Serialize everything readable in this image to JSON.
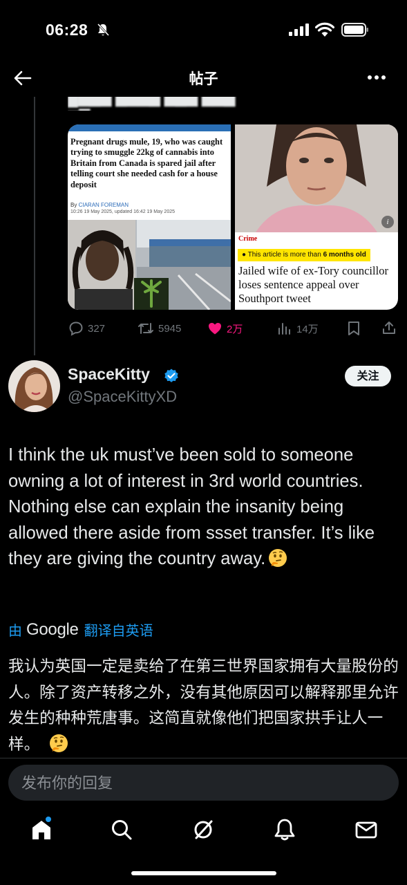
{
  "status_bar": {
    "time": "06:28"
  },
  "header": {
    "title": "帖子"
  },
  "quoted_post": {
    "article_left": {
      "headline": "Pregnant drugs mule, 19, who was caught trying to smuggle 22kg of cannabis into Britain from Canada is spared jail after telling court she needed cash for a house deposit",
      "byline_prefix": "By",
      "byline_author": "CIARAN FOREMAN",
      "dateline": "10:26 19 May 2025, updated 16:42 19 May 2025"
    },
    "article_right": {
      "section": "Crime",
      "age_prefix": "This article is more than",
      "age_value": "6 months old",
      "headline": "Jailed wife of ex-Tory councillor loses sentence appeal over Southport tweet"
    },
    "actions": {
      "replies": "327",
      "reposts": "5945",
      "likes": "2万",
      "views": "14万"
    }
  },
  "author": {
    "name": "SpaceKitty",
    "handle": "@SpaceKittyXD",
    "follow_label": "关注"
  },
  "post": {
    "text": "I think the uk must’ve been sold to someone owning a lot of interest in 3rd world countries. Nothing else can explain the insanity being allowed there aside from ssset transfer. It’s like they are giving the country away.",
    "translation_prefix": "由",
    "translation_provider": "Google",
    "translation_suffix": "翻译自英语",
    "translated_text": "我认为英国一定是卖给了在第三世界国家拥有大量股份的人。除了资产转移之外，没有其他原因可以解释那里允许发生的种种荒唐事。这简直就像他们把国家拱手让人一样。"
  },
  "reply": {
    "placeholder": "发布你的回复"
  },
  "colors": {
    "accent": "#1d9bf0",
    "like": "#f91880",
    "muted": "#71767b",
    "background": "#000000"
  },
  "icons": [
    "back-arrow-icon",
    "more-icon",
    "reply-icon",
    "repost-icon",
    "like-icon",
    "views-icon",
    "bookmark-icon",
    "share-icon",
    "verified-icon",
    "thinking-face-emoji",
    "home-icon",
    "search-icon",
    "grok-icon",
    "notifications-icon",
    "messages-icon"
  ]
}
